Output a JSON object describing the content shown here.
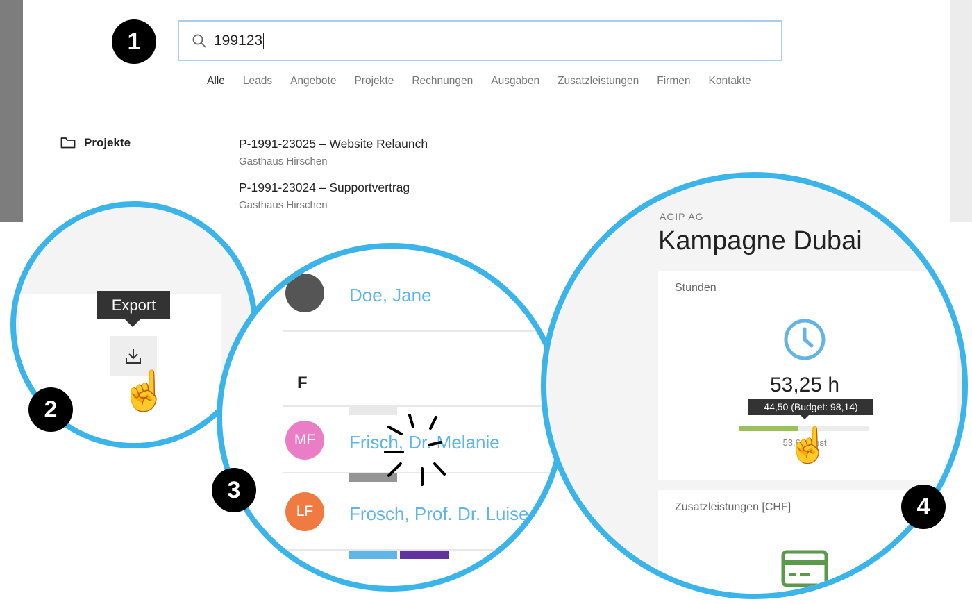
{
  "search": {
    "value": "199123",
    "icon": "search-icon"
  },
  "tabs": [
    "Alle",
    "Leads",
    "Angebote",
    "Projekte",
    "Rechnungen",
    "Ausgaben",
    "Zusatzleistungen",
    "Firmen",
    "Kontakte"
  ],
  "results": {
    "category": "Projekte",
    "items": [
      {
        "title": "P-1991-23025 – Website Relaunch",
        "subtitle": "Gasthaus Hirschen"
      },
      {
        "title": "P-1991-23024 – Supportvertrag",
        "subtitle": "Gasthaus Hirschen"
      }
    ]
  },
  "badges": [
    "1",
    "2",
    "3",
    "4"
  ],
  "export": {
    "tooltip": "Export",
    "icon": "download-icon"
  },
  "contacts": {
    "section": "F",
    "items": [
      {
        "name": "Doe, Jane",
        "initials": ""
      },
      {
        "name": "Frisch, Dr. Melanie",
        "initials": "MF",
        "color": "#e97dc6"
      },
      {
        "name": "Frosch, Prof. Dr. Luise",
        "initials": "LF",
        "color": "#ef7b40"
      }
    ]
  },
  "project": {
    "company": "AGIP AG",
    "title": "Kampagne Dubai",
    "hours": {
      "label": "Stunden",
      "value": "53,25 h",
      "tooltip": "44,50 (Budget: 98,14)",
      "rest": "53,64 Rest",
      "progress": 0.45
    },
    "extras": {
      "label": "Zusatzleistungen [CHF]"
    }
  },
  "colors": {
    "accent": "#3bb4ea",
    "progress": "#9bc15b",
    "link": "#5fb5e6"
  }
}
